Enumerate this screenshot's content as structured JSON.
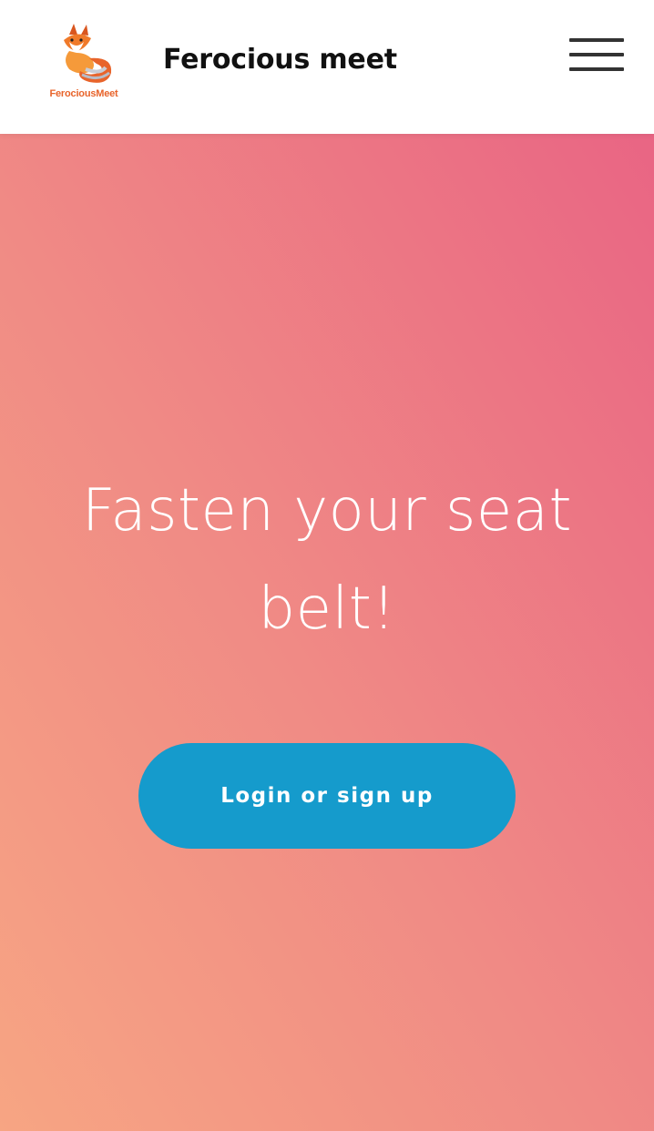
{
  "header": {
    "logo_text": "FerociousMeet",
    "site_title": "Ferocious meet",
    "menu_icon": "hamburger-menu-icon"
  },
  "hero": {
    "heading": "Fasten your seat belt!",
    "cta_label": "Login or sign up"
  },
  "colors": {
    "cta_background": "#159bcc",
    "gradient_start": "#f7a583",
    "gradient_end": "#e96584",
    "logo_accent": "#e8642b"
  }
}
